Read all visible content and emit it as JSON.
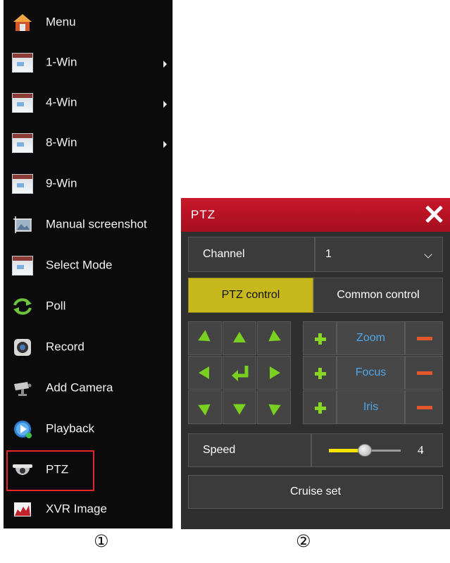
{
  "menu": {
    "items": [
      {
        "label": "Menu",
        "icon": "home-icon",
        "submenu": false
      },
      {
        "label": "1-Win",
        "icon": "window-icon",
        "submenu": true
      },
      {
        "label": "4-Win",
        "icon": "window-icon",
        "submenu": true
      },
      {
        "label": "8-Win",
        "icon": "window-icon",
        "submenu": true
      },
      {
        "label": "9-Win",
        "icon": "window-icon",
        "submenu": false
      },
      {
        "label": "Manual screenshot",
        "icon": "screenshot-icon",
        "submenu": false
      },
      {
        "label": "Select Mode",
        "icon": "window-icon",
        "submenu": false
      },
      {
        "label": "Poll",
        "icon": "poll-arrows-icon",
        "submenu": false
      },
      {
        "label": "Record",
        "icon": "record-icon",
        "submenu": false
      },
      {
        "label": "Add Camera",
        "icon": "camera-icon",
        "submenu": false
      },
      {
        "label": "Playback",
        "icon": "playback-icon",
        "submenu": false
      },
      {
        "label": "PTZ",
        "icon": "dome-camera-icon",
        "submenu": false,
        "highlighted": true
      },
      {
        "label": "XVR Image",
        "icon": "image-chart-icon",
        "submenu": false
      }
    ],
    "highlight_color": "#e3262b"
  },
  "ptz_dialog": {
    "title": "PTZ",
    "channel_label": "Channel",
    "channel_value": "1",
    "tabs": [
      {
        "label": "PTZ control",
        "active": true
      },
      {
        "label": "Common control",
        "active": false
      }
    ],
    "lens_controls": [
      "Zoom",
      "Focus",
      "Iris"
    ],
    "speed_label": "Speed",
    "speed_value": "4",
    "speed_fraction": 0.5,
    "cruise_label": "Cruise set",
    "colors": {
      "title_bar": "#c8182a",
      "active_tab": "#c7b81d",
      "arrow": "#79d021",
      "plus": "#86d624",
      "minus": "#e2572b",
      "lens_label": "#4fa6e8",
      "slider_fill": "#f5e400"
    }
  },
  "captions": {
    "left": "①",
    "right": "②"
  }
}
